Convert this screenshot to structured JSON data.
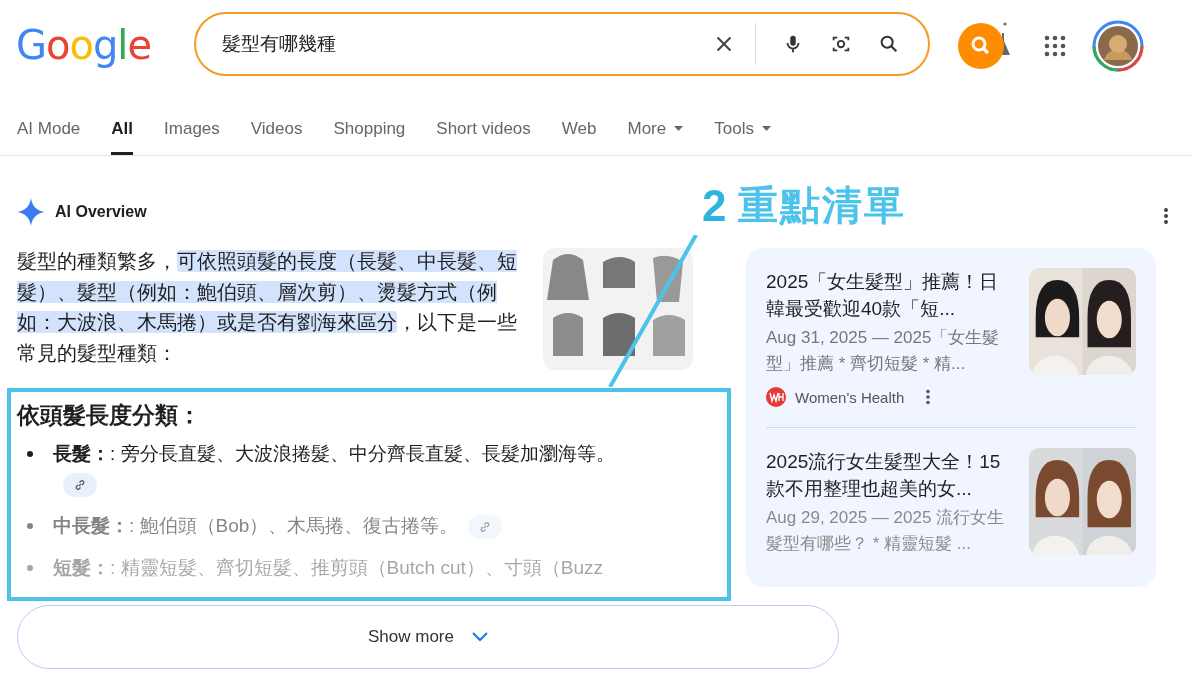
{
  "header": {
    "logo": "Google",
    "search": {
      "value": "髮型有哪幾種"
    }
  },
  "tabs": [
    {
      "label": "AI Mode",
      "selected": false,
      "kind": "plain"
    },
    {
      "label": "All",
      "selected": true,
      "kind": "plain"
    },
    {
      "label": "Images",
      "selected": false,
      "kind": "plain"
    },
    {
      "label": "Videos",
      "selected": false,
      "kind": "plain"
    },
    {
      "label": "Shopping",
      "selected": false,
      "kind": "plain"
    },
    {
      "label": "Short videos",
      "selected": false,
      "kind": "plain"
    },
    {
      "label": "Web",
      "selected": false,
      "kind": "plain"
    },
    {
      "label": "More",
      "selected": false,
      "kind": "menu"
    },
    {
      "label": "Tools",
      "selected": false,
      "kind": "menu"
    }
  ],
  "overview": {
    "title": "AI Overview",
    "intro": [
      {
        "text": "髮型的種類繁多，",
        "highlighted": false
      },
      {
        "text": "可依照頭髮的長度（長髮、中長髮、短髮）、髮型（例如：鮑伯頭、層次剪）、燙髮方式（例如：大波浪、木馬捲）或是否有劉海來區分",
        "highlighted": true
      },
      {
        "text": "，以下是一些常見的髮型種類：",
        "highlighted": false
      }
    ],
    "heading": "依頭髮長度分類：",
    "items": [
      {
        "label": "長髮：",
        "text": ": 旁分長直髮、大波浪捲髮、中分齊長直髮、長髮加瀏海等。",
        "link": true
      },
      {
        "label": "中長髮：",
        "text": ": 鮑伯頭（Bob）、木馬捲、復古捲等。",
        "link": true
      },
      {
        "label": "短髮：",
        "text": ": 精靈短髮、齊切短髮、推剪頭（Butch cut）、寸頭（Buzz",
        "link": false
      }
    ],
    "show_more": "Show more"
  },
  "sources": [
    {
      "title": "2025「女生髮型」推薦！日韓最受歡迎40款「短...",
      "snippet": "Aug 31, 2025 — 2025「女生髮型」推薦 * 齊切短髮 * 精...",
      "source": "Women's Health"
    },
    {
      "title": "2025流行女生髮型大全！15款不用整理也超美的女...",
      "snippet": "Aug 29, 2025 — 2025 流行女生髮型有哪些？ * 精靈短髮 ..."
    }
  ],
  "annotation": {
    "number": "2",
    "label": "重點清單"
  }
}
